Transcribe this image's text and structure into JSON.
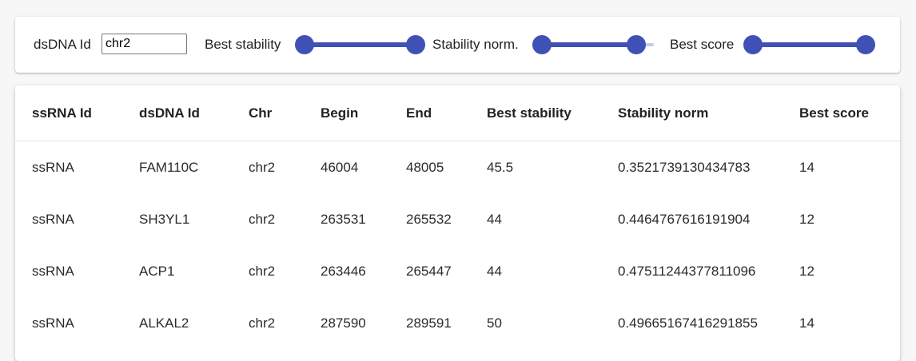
{
  "filters": {
    "dsdna_label": "dsDNA Id",
    "dsdna_value": "chr2",
    "best_stability_label": "Best stability",
    "best_stability_range": [
      0,
      1
    ],
    "stability_norm_label": "Stability norm.",
    "stability_norm_range": [
      0,
      0.84
    ],
    "best_score_label": "Best score",
    "best_score_range": [
      0,
      1
    ]
  },
  "table": {
    "columns": [
      "ssRNA Id",
      "dsDNA Id",
      "Chr",
      "Begin",
      "End",
      "Best stability",
      "Stability norm",
      "Best score"
    ],
    "rows": [
      [
        "ssRNA",
        "FAM110C",
        "chr2",
        "46004",
        "48005",
        "45.5",
        "0.3521739130434783",
        "14"
      ],
      [
        "ssRNA",
        "SH3YL1",
        "chr2",
        "263531",
        "265532",
        "44",
        "0.4464767616191904",
        "12"
      ],
      [
        "ssRNA",
        "ACP1",
        "chr2",
        "263446",
        "265447",
        "44",
        "0.47511244377811096",
        "12"
      ],
      [
        "ssRNA",
        "ALKAL2",
        "chr2",
        "287590",
        "289591",
        "50",
        "0.49665167416291855",
        "14"
      ]
    ]
  },
  "colors": {
    "slider_primary": "#3f51b5",
    "slider_rail": "#c5cae9"
  }
}
